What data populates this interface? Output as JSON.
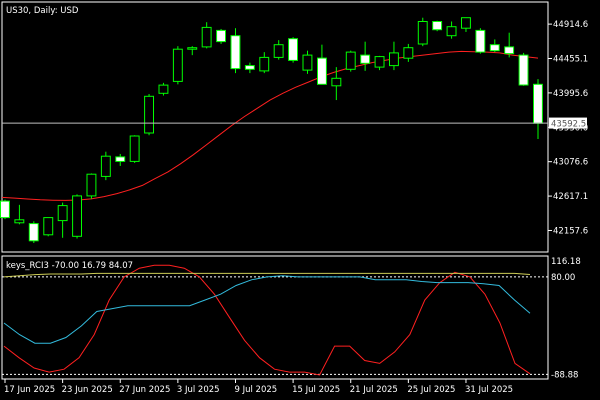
{
  "window": {
    "title": "US30, Daily:  USD"
  },
  "indicator": {
    "label": "keys_RCI3 -70.00 16.79 84.07",
    "levels": [
      80,
      -88.88
    ],
    "level_labels": [
      "80.00",
      "-88.88"
    ],
    "scale_top_label": "116.18"
  },
  "colors": {
    "background": "#000000",
    "frame": "#ffffff",
    "bull_candle": "#000000",
    "bear_candle": "#ffffff",
    "wick": "#00ff00",
    "moving_average": "#ff2020",
    "current_price_line": "#c0c0c0",
    "rci_fast": "#ff2020",
    "rci_mid": "#33bbdd",
    "rci_slow": "#cccc55",
    "level_line": "#ffffff"
  },
  "chart_data": [
    {
      "type": "candlestick",
      "symbol": "US30",
      "timeframe": "Daily",
      "currency": "USD",
      "x_tick_labels": [
        "17 Jun 2025",
        "23 Jun 2025",
        "27 Jun 2025",
        "3 Jul 2025",
        "9 Jul 2025",
        "15 Jul 2025",
        "21 Jul 2025",
        "25 Jul 2025",
        "31 Jul 2025"
      ],
      "x_tick_index": [
        0,
        4,
        8,
        12,
        16,
        20,
        24,
        28,
        32
      ],
      "y_tick_labels": [
        "44914.6",
        "44455.1",
        "43995.6",
        "43536.0",
        "43076.6",
        "42617.1",
        "42157.6"
      ],
      "y_ticks": [
        44914.6,
        44455.1,
        43995.6,
        43536.0,
        43076.6,
        42617.1,
        42157.6
      ],
      "ylim": [
        41870,
        45210
      ],
      "current_price": 43592.5,
      "current_price_label": "43592.5",
      "candles": [
        {
          "o": 42550,
          "h": 42570,
          "l": 42310,
          "c": 42330
        },
        {
          "o": 42260,
          "h": 42500,
          "l": 42240,
          "c": 42300
        },
        {
          "o": 42250,
          "h": 42280,
          "l": 41990,
          "c": 42020
        },
        {
          "o": 42100,
          "h": 42330,
          "l": 42080,
          "c": 42330
        },
        {
          "o": 42290,
          "h": 42530,
          "l": 42060,
          "c": 42490
        },
        {
          "o": 42080,
          "h": 42640,
          "l": 42050,
          "c": 42620
        },
        {
          "o": 42620,
          "h": 42920,
          "l": 42580,
          "c": 42910
        },
        {
          "o": 42880,
          "h": 43210,
          "l": 42830,
          "c": 43150
        },
        {
          "o": 43140,
          "h": 43180,
          "l": 43020,
          "c": 43080
        },
        {
          "o": 43080,
          "h": 43430,
          "l": 43060,
          "c": 43420
        },
        {
          "o": 43460,
          "h": 43980,
          "l": 43430,
          "c": 43950
        },
        {
          "o": 43990,
          "h": 44130,
          "l": 43960,
          "c": 44100
        },
        {
          "o": 44150,
          "h": 44620,
          "l": 44110,
          "c": 44580
        },
        {
          "o": 44580,
          "h": 44620,
          "l": 44500,
          "c": 44600
        },
        {
          "o": 44610,
          "h": 44940,
          "l": 44590,
          "c": 44870
        },
        {
          "o": 44830,
          "h": 44850,
          "l": 44650,
          "c": 44680
        },
        {
          "o": 44760,
          "h": 44860,
          "l": 44260,
          "c": 44320
        },
        {
          "o": 44360,
          "h": 44400,
          "l": 44260,
          "c": 44310
        },
        {
          "o": 44290,
          "h": 44540,
          "l": 44260,
          "c": 44470
        },
        {
          "o": 44470,
          "h": 44700,
          "l": 44440,
          "c": 44640
        },
        {
          "o": 44720,
          "h": 44740,
          "l": 44400,
          "c": 44430
        },
        {
          "o": 44300,
          "h": 44560,
          "l": 44250,
          "c": 44500
        },
        {
          "o": 44460,
          "h": 44640,
          "l": 44110,
          "c": 44110
        },
        {
          "o": 44090,
          "h": 44340,
          "l": 43900,
          "c": 44190
        },
        {
          "o": 44310,
          "h": 44560,
          "l": 44280,
          "c": 44540
        },
        {
          "o": 44500,
          "h": 44680,
          "l": 44290,
          "c": 44390
        },
        {
          "o": 44340,
          "h": 44490,
          "l": 44300,
          "c": 44480
        },
        {
          "o": 44360,
          "h": 44680,
          "l": 44300,
          "c": 44530
        },
        {
          "o": 44460,
          "h": 44650,
          "l": 44410,
          "c": 44600
        },
        {
          "o": 44650,
          "h": 45000,
          "l": 44620,
          "c": 44950
        },
        {
          "o": 44950,
          "h": 44960,
          "l": 44820,
          "c": 44840
        },
        {
          "o": 44760,
          "h": 44950,
          "l": 44720,
          "c": 44880
        },
        {
          "o": 44860,
          "h": 45000,
          "l": 44810,
          "c": 45000
        },
        {
          "o": 44830,
          "h": 44860,
          "l": 44520,
          "c": 44540
        },
        {
          "o": 44640,
          "h": 44710,
          "l": 44540,
          "c": 44560
        },
        {
          "o": 44610,
          "h": 44800,
          "l": 44470,
          "c": 44520
        },
        {
          "o": 44500,
          "h": 44530,
          "l": 44090,
          "c": 44100
        },
        {
          "o": 44110,
          "h": 44180,
          "l": 43380,
          "c": 43590
        }
      ],
      "moving_average": [
        42600,
        42590,
        42578,
        42568,
        42562,
        42560,
        42565,
        42580,
        42610,
        42650,
        42700,
        42760,
        42850,
        42940,
        43050,
        43170,
        43300,
        43430,
        43560,
        43680,
        43790,
        43900,
        43990,
        44070,
        44140,
        44210,
        44270,
        44320,
        44360,
        44400,
        44430,
        44460,
        44480,
        44500,
        44520,
        44540,
        44550,
        44545,
        44540,
        44530,
        44500,
        44480,
        44460
      ]
    },
    {
      "type": "line",
      "name": "keys_RCI3",
      "ylim": [
        -97,
        116.18
      ],
      "levels": [
        80,
        -88.88
      ],
      "current_values": [
        -70.0,
        16.79,
        84.07
      ],
      "series": [
        {
          "values": [
            -40,
            -60,
            -78,
            -85,
            -80,
            -60,
            -20,
            40,
            80,
            95,
            100,
            100,
            95,
            80,
            50,
            10,
            -30,
            -60,
            -80,
            -85,
            -85,
            -90,
            -40,
            -40,
            -65,
            -70,
            -50,
            -20,
            40,
            70,
            88,
            80,
            50,
            0,
            -70,
            -88
          ]
        },
        {
          "values": [
            0,
            -20,
            -35,
            -35,
            -25,
            -5,
            20,
            25,
            30,
            30,
            30,
            30,
            30,
            40,
            50,
            65,
            75,
            80,
            82,
            80,
            80,
            80,
            80,
            80,
            75,
            75,
            75,
            72,
            70,
            70,
            70,
            68,
            65,
            40,
            16.79
          ]
        },
        {
          "values": [
            80,
            82,
            84,
            85,
            85,
            85,
            86,
            86,
            86,
            86,
            86,
            86,
            86,
            86,
            86,
            86,
            86,
            86,
            86,
            86,
            86,
            86,
            86,
            86,
            86,
            86,
            86,
            86,
            86,
            86,
            86,
            86,
            86,
            86,
            84.07
          ]
        }
      ]
    }
  ]
}
